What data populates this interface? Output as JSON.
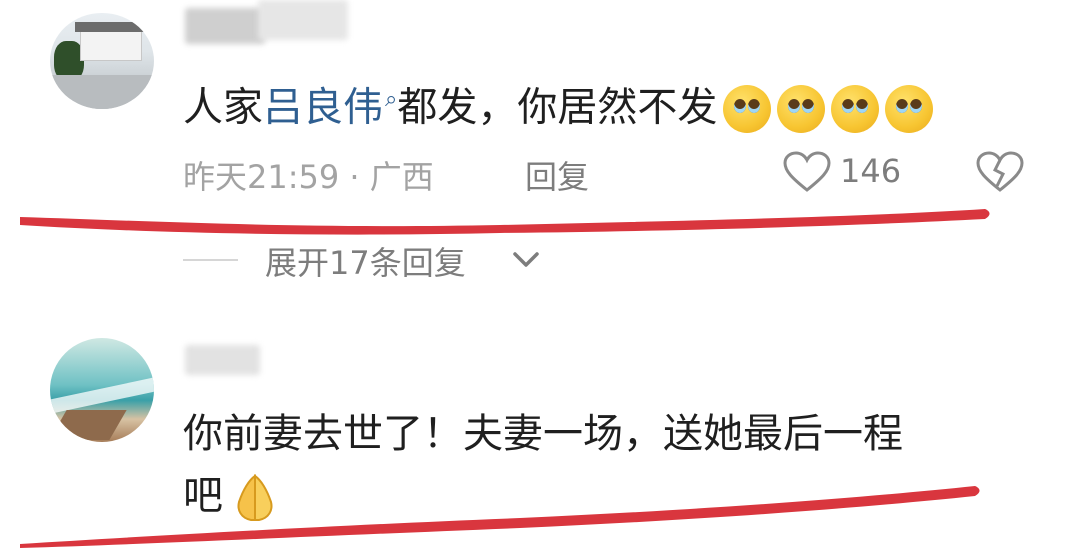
{
  "comments": [
    {
      "text_prefix": "人家",
      "mention": "吕良伟",
      "text_suffix": "都发，你居然不发",
      "emojis": [
        "pleading-face-emoji",
        "pleading-face-emoji",
        "pleading-face-emoji",
        "pleading-face-emoji"
      ],
      "time_location": "昨天21:59 · 广西",
      "reply_label": "回复",
      "likes": "146"
    },
    {
      "line1": "你前妻去世了！夫妻一场，送她最后一程",
      "line2": "吧",
      "emoji": "folded-hands-emoji"
    }
  ],
  "expand_replies_label": "展开17条回复",
  "colors": {
    "mention": "#2f5f91",
    "highlight_marker": "#d9363e"
  }
}
